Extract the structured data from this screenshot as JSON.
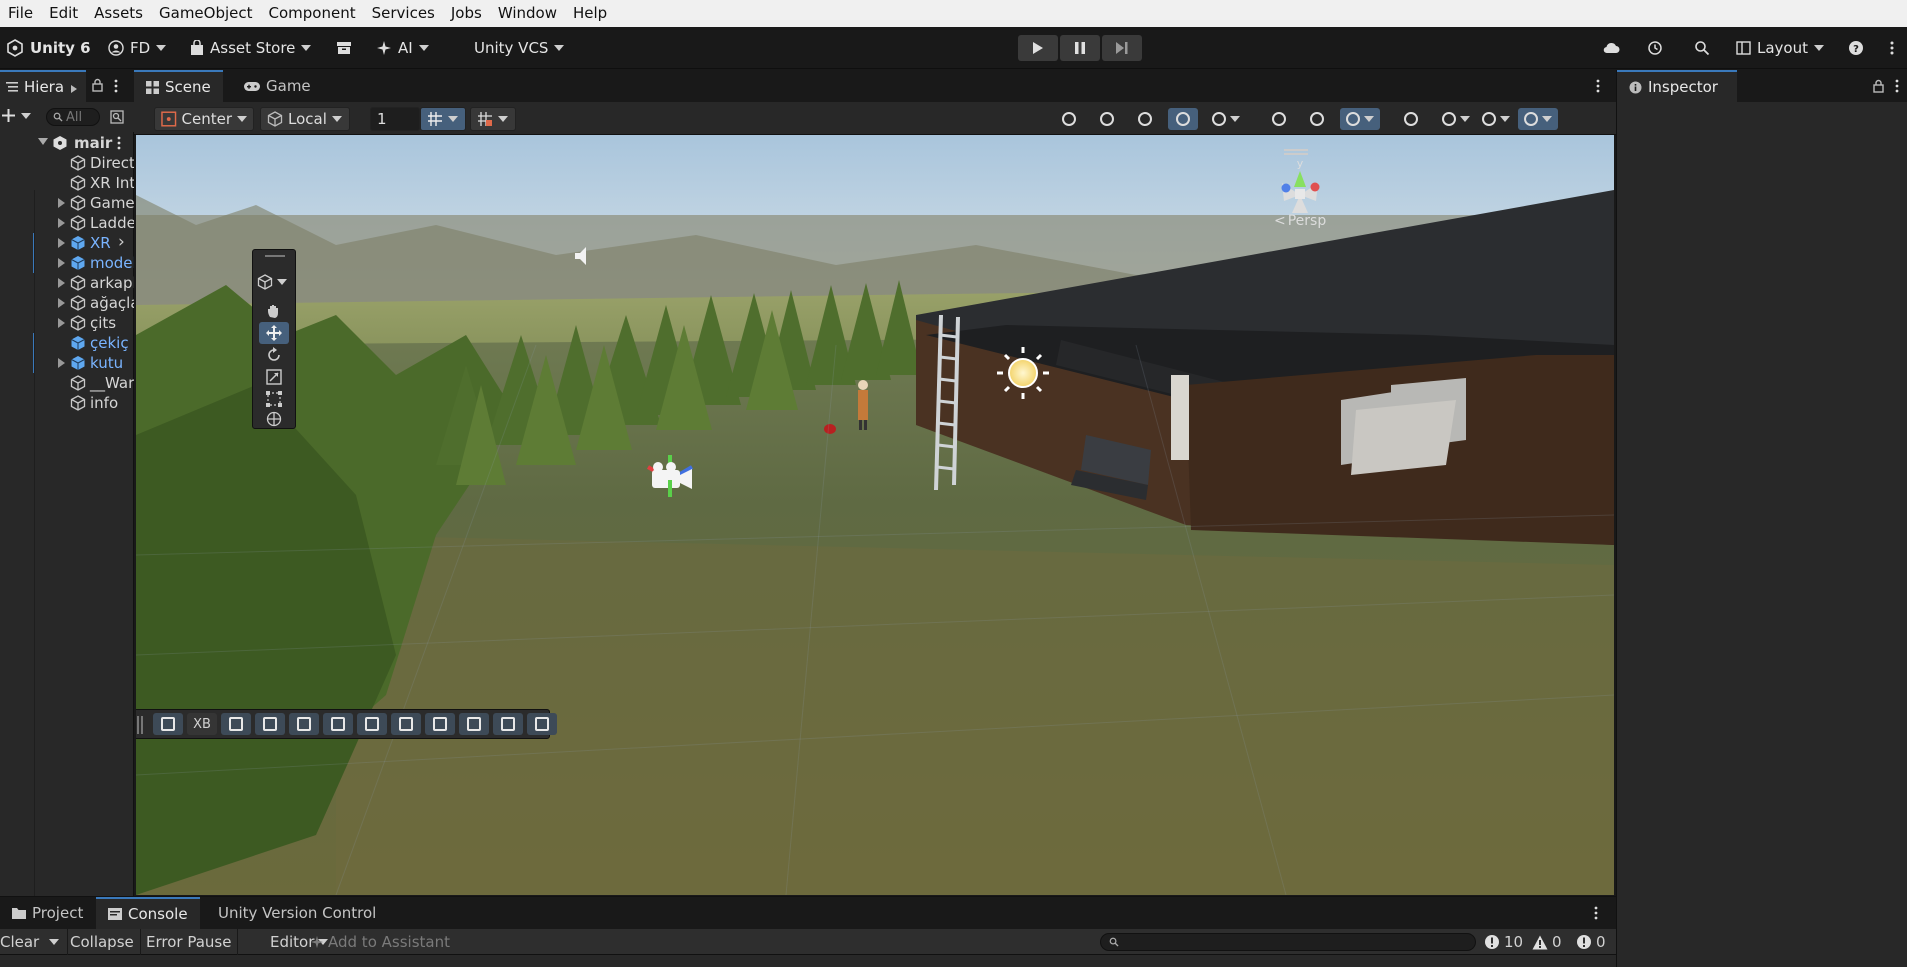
{
  "menu": [
    "File",
    "Edit",
    "Assets",
    "GameObject",
    "Component",
    "Services",
    "Jobs",
    "Window",
    "Help"
  ],
  "toolbar": {
    "unity_label": "Unity 6",
    "account_label": "FD",
    "asset_store_label": "Asset Store",
    "ai_label": "AI",
    "vcs_label": "Unity VCS",
    "layout_label": "Layout"
  },
  "hierarchy": {
    "tab_label": "Hierar",
    "search_placeholder": "All",
    "scene_root": "mair",
    "items": [
      {
        "label": "Direct",
        "expandable": false,
        "prefab": false
      },
      {
        "label": "XR Int",
        "expandable": false,
        "prefab": false
      },
      {
        "label": "Game",
        "expandable": true,
        "prefab": false
      },
      {
        "label": "Ladde",
        "expandable": true,
        "prefab": false
      },
      {
        "label": "XR",
        "expandable": true,
        "prefab": true
      },
      {
        "label": "model",
        "expandable": true,
        "prefab": true
      },
      {
        "label": "arkapl",
        "expandable": true,
        "prefab": false
      },
      {
        "label": "ağaçla",
        "expandable": true,
        "prefab": false
      },
      {
        "label": "çits",
        "expandable": true,
        "prefab": false
      },
      {
        "label": "çekiç",
        "expandable": false,
        "prefab": true
      },
      {
        "label": "kutu",
        "expandable": true,
        "prefab": true
      },
      {
        "label": "__War",
        "expandable": false,
        "prefab": false
      },
      {
        "label": "info",
        "expandable": false,
        "prefab": false
      }
    ]
  },
  "scene": {
    "tabs": [
      {
        "label": "Scene",
        "active": true
      },
      {
        "label": "Game",
        "active": false
      }
    ],
    "pivot_label": "Center",
    "space_label": "Local",
    "snap_value": "1",
    "persp_label": "Persp",
    "gizmo_axis_label": "y",
    "overlay_labels": [
      "XB"
    ]
  },
  "inspector": {
    "tab_label": "Inspector"
  },
  "console": {
    "tabs": [
      {
        "label": "Project",
        "active": false
      },
      {
        "label": "Console",
        "active": true
      },
      {
        "label": "Unity Version Control",
        "active": false
      }
    ],
    "clear_label": "Clear",
    "collapse_label": "Collapse",
    "error_pause_label": "Error Pause",
    "editor_label": "Editor",
    "assistant_label": "Add to Assistant",
    "counts": {
      "errors": "10",
      "warnings": "0",
      "messages": "0"
    }
  },
  "colors": {
    "accent": "#3a79bb",
    "prefab": "#7ab4ff",
    "panel": "#282828",
    "toolbar": "#191919"
  }
}
